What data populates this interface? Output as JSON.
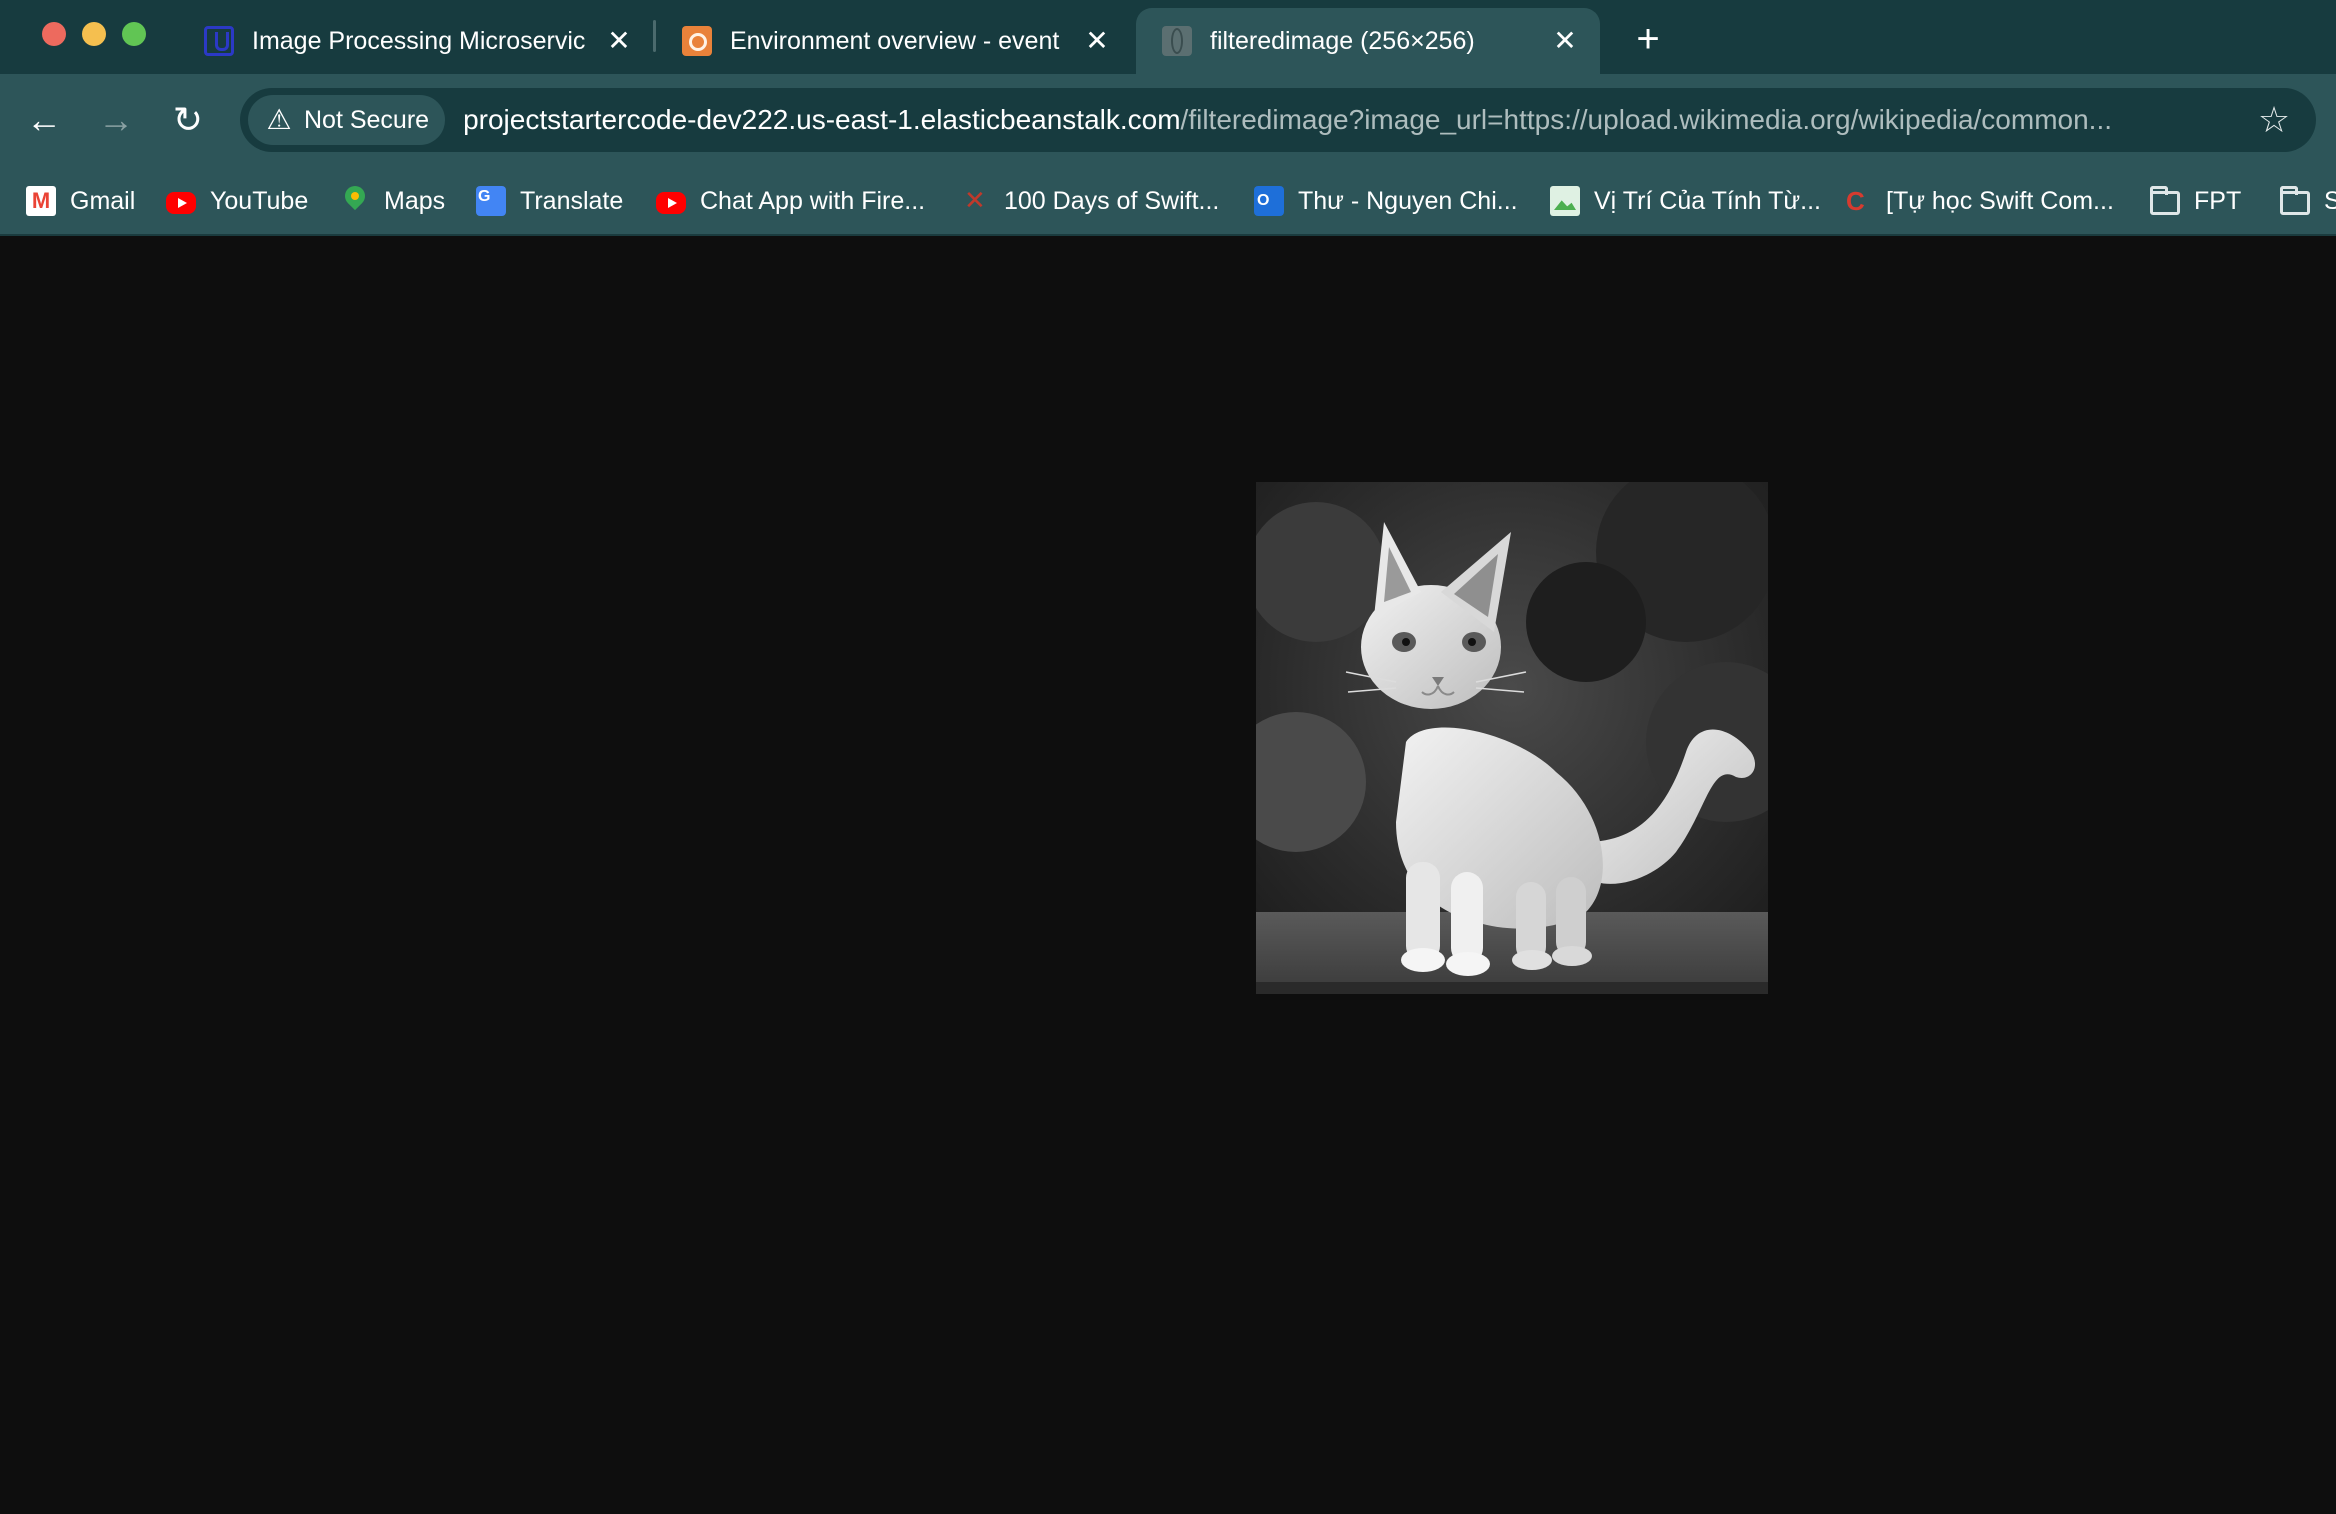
{
  "window": {
    "traffic_lights": [
      "close",
      "minimize",
      "zoom"
    ]
  },
  "tabs": [
    {
      "title": "Image Processing Microservic",
      "icon": "udacity-icon",
      "active": false
    },
    {
      "title": "Environment overview - event",
      "icon": "aws-elastic-beanstalk-icon",
      "active": false
    },
    {
      "title": "filteredimage (256×256)",
      "icon": "globe-icon",
      "active": true
    }
  ],
  "toolbar": {
    "back_icon": "←",
    "forward_icon": "→",
    "reload_icon": "↻",
    "security_label": "Not Secure",
    "url_host": "projectstartercode-dev222.us-east-1.elasticbeanstalk.com",
    "url_path": "/filteredimage?image_url=https://upload.wikimedia.org/wikipedia/common...",
    "bookmark_star": "☆"
  },
  "bookmarks": [
    {
      "label": "Gmail",
      "icon": "gmail-icon"
    },
    {
      "label": "YouTube",
      "icon": "youtube-icon"
    },
    {
      "label": "Maps",
      "icon": "maps-icon"
    },
    {
      "label": "Translate",
      "icon": "translate-icon"
    },
    {
      "label": "Chat App with Fire...",
      "icon": "youtube-icon"
    },
    {
      "label": "100 Days of Swift...",
      "icon": "swift-icon"
    },
    {
      "label": "Thư - Nguyen Chi...",
      "icon": "outlook-icon"
    },
    {
      "label": "Vị Trí Của Tính Từ...",
      "icon": "image-icon"
    },
    {
      "label": "[Tự học Swift Com...",
      "icon": "c-icon"
    },
    {
      "label": "FPT",
      "icon": "folder-icon"
    },
    {
      "label": "S",
      "icon": "folder-icon"
    }
  ],
  "content": {
    "image_description": "grayscale cat",
    "image_size": "256×256"
  },
  "colors": {
    "tabstrip_bg": "#173b3f",
    "toolbar_bg": "#2d5559",
    "page_bg": "#0e0e0e"
  }
}
